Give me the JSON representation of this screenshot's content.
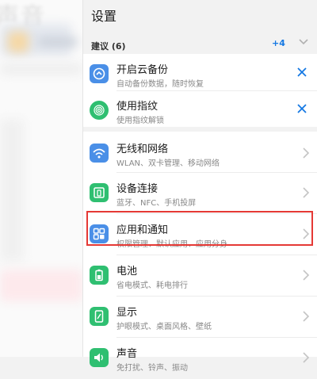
{
  "background_app": {
    "title": "声音"
  },
  "settings": {
    "title": "设置",
    "suggestions": {
      "header": "建议 (6)",
      "more_count": "+4",
      "items": [
        {
          "label": "开启云备份",
          "subtitle": "自动备份数据，随时恢复",
          "icon": "cloud-backup-icon"
        },
        {
          "label": "使用指纹",
          "subtitle": "使用指纹解锁",
          "icon": "fingerprint-icon"
        }
      ]
    },
    "items": [
      {
        "label": "无线和网络",
        "subtitle": "WLAN、双卡管理、移动网络",
        "icon": "wifi-icon",
        "color": "#4a8fe7"
      },
      {
        "label": "设备连接",
        "subtitle": "蓝牙、NFC、手机投屏",
        "icon": "device-connection-icon",
        "color": "#2fbf71"
      },
      {
        "label": "应用和通知",
        "subtitle": "权限管理、默认应用、应用分身",
        "icon": "apps-icon",
        "color": "#4a8fe7",
        "highlighted": true
      },
      {
        "label": "电池",
        "subtitle": "省电模式、耗电排行",
        "icon": "battery-icon",
        "color": "#2fbf71"
      },
      {
        "label": "显示",
        "subtitle": "护眼模式、桌面风格、壁纸",
        "icon": "display-icon",
        "color": "#2fbf71"
      },
      {
        "label": "声音",
        "subtitle": "免打扰、铃声、振动",
        "icon": "sound-icon",
        "color": "#2fbf71"
      }
    ]
  },
  "colors": {
    "accent": "#1478e3",
    "highlight_border": "#e53935"
  }
}
